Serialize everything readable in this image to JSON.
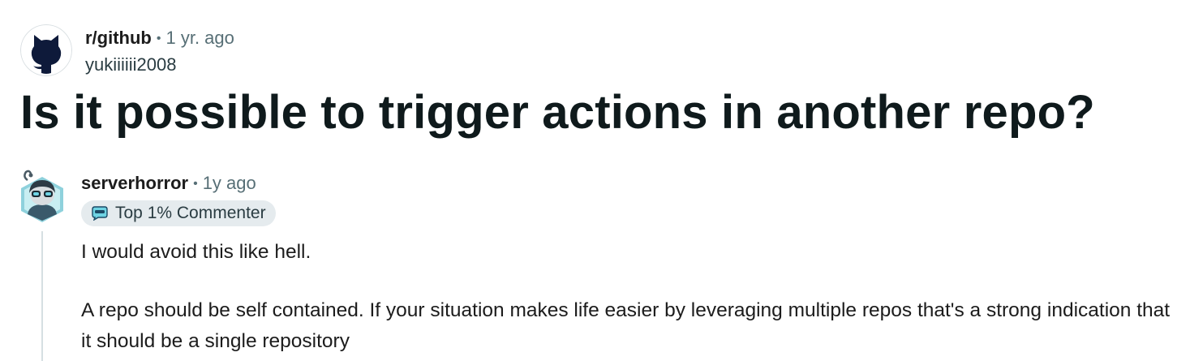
{
  "post": {
    "subreddit": "r/github",
    "separator": "•",
    "age": "1 yr. ago",
    "author": "yukiiiiii2008",
    "title": "Is it possible to trigger actions in another repo?"
  },
  "comment": {
    "author": "serverhorror",
    "separator": "•",
    "age": "1y ago",
    "badge": "Top 1% Commenter",
    "paragraphs": [
      "I would avoid this like hell.",
      "A repo should be self contained. If your situation makes life easier by leveraging multiple repos that's a strong indication that it should be a single repository"
    ]
  },
  "icons": {
    "subreddit_avatar": "github-octocat-icon",
    "commenter_avatar": "snoo-avatar-icon",
    "badge_icon": "top-commenter-badge-icon"
  },
  "colors": {
    "meta_gray": "#576f76",
    "badge_bg": "#e5ebee",
    "thread_line": "#d6dfe2",
    "avatar_navy": "#0e1a3a"
  }
}
